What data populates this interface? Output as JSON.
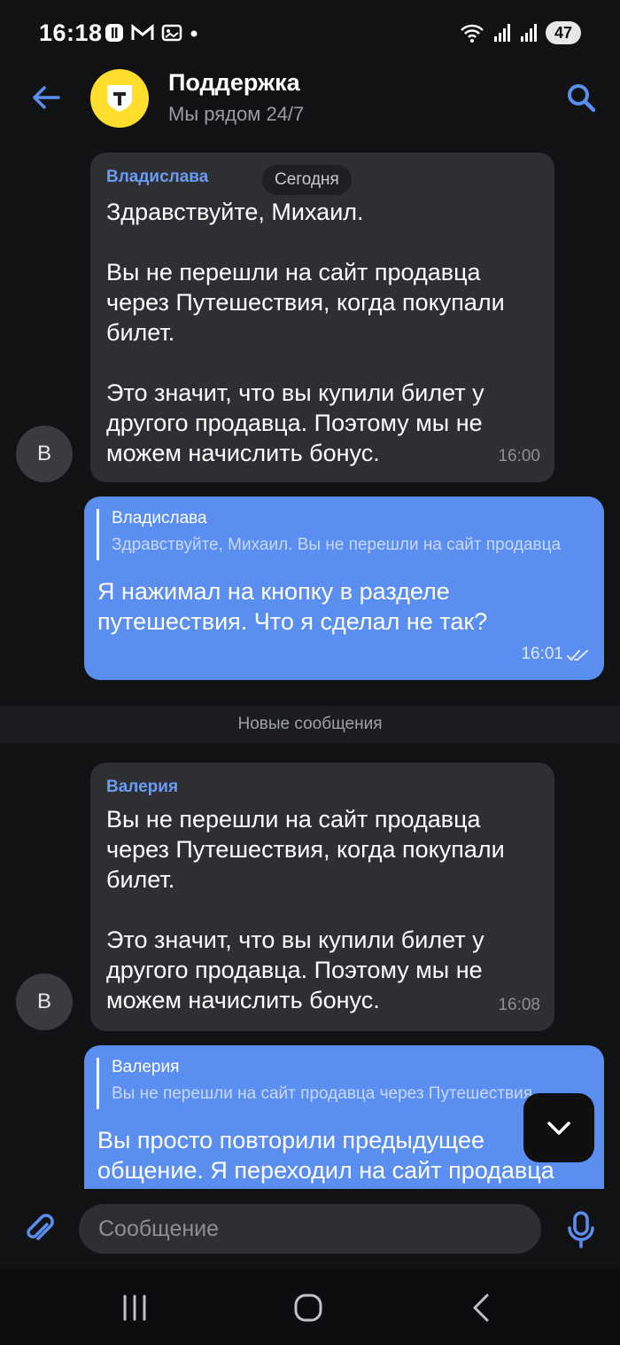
{
  "status_bar": {
    "time": "16:18",
    "notifications": [
      "app-notif-icon",
      "gmail-icon",
      "gallery-icon"
    ],
    "battery": "47"
  },
  "header": {
    "title": "Поддержка",
    "subtitle": "Мы рядом 24/7",
    "avatar_color": "#ffdd2d"
  },
  "date_chip": "Сегодня",
  "messages": [
    {
      "direction": "in",
      "sender": "Владислава",
      "text": "Здравствуйте, Михаил.\n\nВы не перешли на сайт продавца через Путешествия, когда покупали билет.\n\nЭто значит, что вы купили билет у другого продавца. Поэтому мы не можем начислить бонус.",
      "time": "16:00",
      "avatar_letter": "В"
    },
    {
      "direction": "out",
      "reply_to_name": "Владислава",
      "reply_to_text": "Здравствуйте, Михаил.   Вы не перешли на сайт продавца",
      "text": "Я нажимал на кнопку в разделе путешествия. Что я сделал не так?",
      "time": "16:01"
    },
    {
      "direction": "in",
      "sender": "Валерия",
      "text": "Вы не перешли на сайт продавца через Путешествия, когда покупали билет.\n\nЭто значит, что вы купили билет у другого продавца. Поэтому мы не можем начислить бонус.",
      "time": "16:08",
      "avatar_letter": "В"
    },
    {
      "direction": "out",
      "reply_to_name": "Валерия",
      "reply_to_text": "Вы не перешли на сайт продавца через Путешествия",
      "text": "Вы просто повторили предыдущее общение. Я переходил на сайт продавца"
    }
  ],
  "new_messages_label": "Новые сообщения",
  "composer": {
    "placeholder": "Сообщение"
  },
  "colors": {
    "accent": "#5a8ef0",
    "incoming_bubble": "#2e2f33",
    "background": "#111214"
  }
}
